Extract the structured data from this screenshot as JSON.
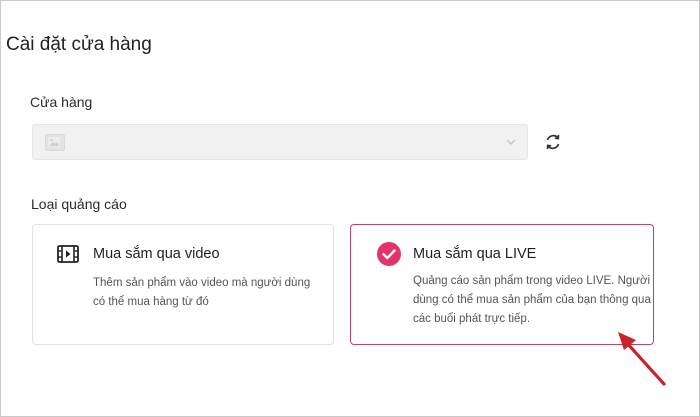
{
  "page": {
    "title": "Cài đặt cửa hàng"
  },
  "store": {
    "label": "Cửa hàng",
    "selected_value": ""
  },
  "ad_type": {
    "label": "Loại quảng cáo",
    "options": [
      {
        "title": "Mua sắm qua video",
        "description": "Thêm sản phẩm vào video mà người dùng có thể mua hàng từ đó",
        "icon": "film-icon",
        "selected": false
      },
      {
        "title": "Mua sắm qua LIVE",
        "description": "Quảng cáo sản phẩm trong video LIVE. Người dùng có thể mua sản phẩm của bạn thông qua các buổi phát trực tiếp.",
        "icon": "check-circle-icon",
        "selected": true
      }
    ]
  },
  "colors": {
    "accent": "#e0356b",
    "selected_border": "#b8466a",
    "arrow": "#c8232b"
  }
}
